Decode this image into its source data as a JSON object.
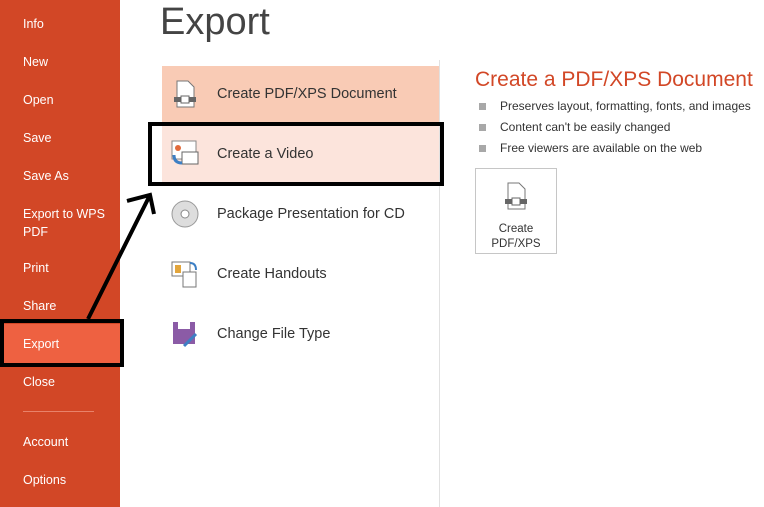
{
  "sidebar": {
    "items": [
      "Info",
      "New",
      "Open",
      "Save",
      "Save As",
      "Export to WPS PDF",
      "Print",
      "Share",
      "Export",
      "Close",
      "Account",
      "Options"
    ],
    "selected": "Export"
  },
  "main": {
    "title": "Export",
    "options": [
      "Create PDF/XPS Document",
      "Create a Video",
      "Package Presentation for CD",
      "Create Handouts",
      "Change File Type"
    ]
  },
  "detail": {
    "title": "Create a PDF/XPS Document",
    "bullets": [
      "Preserves layout, formatting, fonts, and images",
      "Content can't be easily changed",
      "Free viewers are available on the web"
    ],
    "button": "Create PDF/XPS"
  },
  "colors": {
    "accent": "#D24726",
    "selected_nav": "#EE6141",
    "selected_option": "#F9CBB5",
    "hover_option": "#FCE4DC"
  }
}
